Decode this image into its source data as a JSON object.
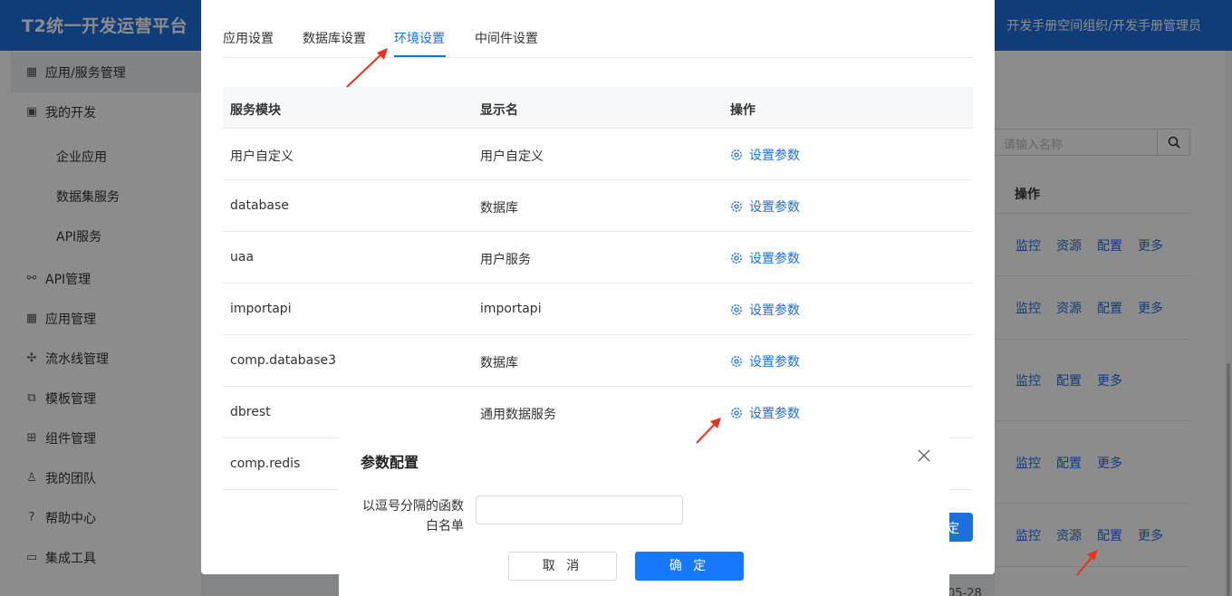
{
  "header": {
    "brand": "T2统一开发运营平台",
    "user": "开发手册空间组织/开发手册管理员"
  },
  "sidebar": {
    "items": [
      {
        "label": "应用/服务管理",
        "icon": "grid-icon"
      },
      {
        "label": "我的开发",
        "icon": "code-icon"
      },
      {
        "label": "API管理",
        "icon": "link-icon"
      },
      {
        "label": "应用管理",
        "icon": "apps-icon"
      },
      {
        "label": "流水线管理",
        "icon": "pipeline-icon"
      },
      {
        "label": "模板管理",
        "icon": "template-icon"
      },
      {
        "label": "组件管理",
        "icon": "component-icon"
      },
      {
        "label": "我的团队",
        "icon": "team-icon"
      },
      {
        "label": "帮助中心",
        "icon": "help-icon"
      },
      {
        "label": "集成工具",
        "icon": "folder-icon"
      }
    ],
    "sub_items": [
      "企业应用",
      "数据集服务",
      "API服务"
    ]
  },
  "background_page": {
    "search_placeholder": "请输入名称",
    "op_header": "操作",
    "rows": [
      [
        "监控",
        "资源",
        "配置",
        "更多"
      ],
      [
        "监控",
        "资源",
        "配置",
        "更多"
      ],
      [
        "监控",
        "配置",
        "更多"
      ],
      [
        "监控",
        "配置",
        "更多"
      ],
      [
        "监控",
        "资源",
        "配置",
        "更多"
      ]
    ],
    "partial_date": "05-28",
    "partial_button": "定"
  },
  "env_modal": {
    "tabs": [
      "应用设置",
      "数据库设置",
      "环境设置",
      "中间件设置"
    ],
    "active_tab": 2,
    "columns": [
      "服务模块",
      "显示名",
      "操作"
    ],
    "rows": [
      {
        "module": "用户自定义",
        "display": "用户自定义",
        "action": "设置参数"
      },
      {
        "module": "database",
        "display": "数据库",
        "action": "设置参数"
      },
      {
        "module": "uaa",
        "display": "用户服务",
        "action": "设置参数"
      },
      {
        "module": "importapi",
        "display": "importapi",
        "action": "设置参数"
      },
      {
        "module": "comp.database3",
        "display": "数据库",
        "action": "设置参数"
      },
      {
        "module": "dbrest",
        "display": "通用数据服务",
        "action": "设置参数"
      },
      {
        "module": "comp.redis",
        "display": "",
        "action": ""
      }
    ]
  },
  "param_dialog": {
    "title": "参数配置",
    "field_label_line1": "以逗号分隔的函数",
    "field_label_line2": "白名单",
    "field_value": "",
    "cancel_label": "取 消",
    "ok_label": "确 定"
  },
  "colors": {
    "primary": "#1e6fd9",
    "button_primary": "#1677ff",
    "annotation_arrow": "#e8321e"
  }
}
